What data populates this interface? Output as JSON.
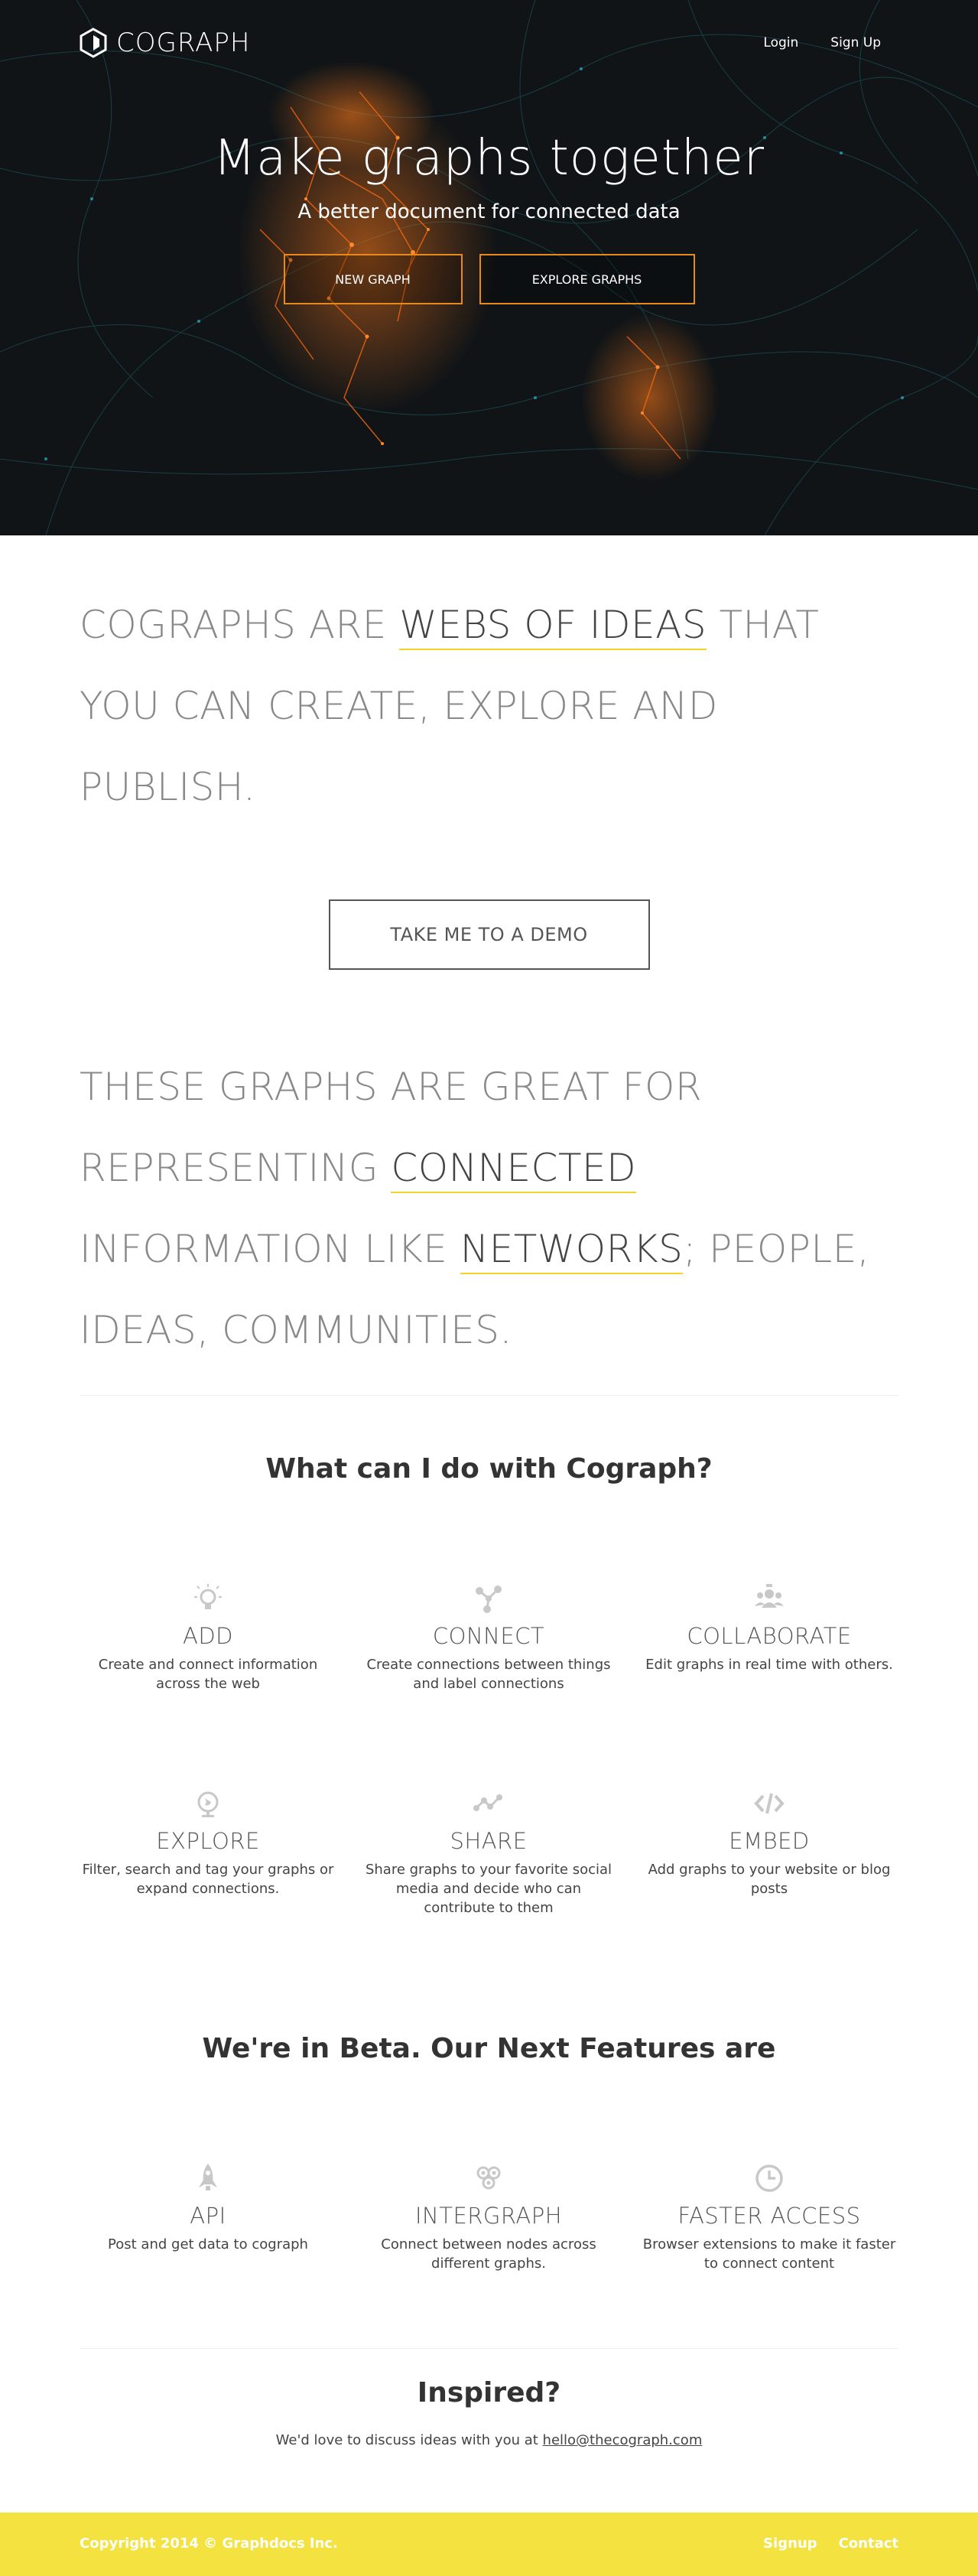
{
  "header": {
    "logo_text": "COGRAPH",
    "nav": {
      "login": "Login",
      "signup": "Sign Up"
    }
  },
  "hero": {
    "title": "Make graphs together",
    "subtitle": "A better document for connected data",
    "new_graph": "NEW GRAPH",
    "explore_graphs": "EXPLORE GRAPHS"
  },
  "statement1": {
    "before": "COGRAPHS ARE ",
    "highlight": "WEBS OF IDEAS",
    "after": " THAT YOU CAN CREATE, EXPLORE AND PUBLISH."
  },
  "demo_button": "TAKE ME TO A DEMO",
  "statement2": {
    "part1": "THESE GRAPHS ARE GREAT FOR REPRESENTING ",
    "highlight1": "CONNECTED",
    "part2": " INFORMATION LIKE ",
    "highlight2": "NETWORKS",
    "part3": "; PEOPLE, IDEAS, COMMUNITIES."
  },
  "what_title": "What can I do with Cograph?",
  "features": [
    {
      "icon": "lightbulb-icon",
      "title": "ADD",
      "desc": "Create and connect information across the web"
    },
    {
      "icon": "connect-icon",
      "title": "CONNECT",
      "desc": "Create connections between things and label connections"
    },
    {
      "icon": "people-icon",
      "title": "COLLABORATE",
      "desc": "Edit graphs in real time with others."
    },
    {
      "icon": "globe-icon",
      "title": "EXPLORE",
      "desc": "Filter, search and tag your graphs or expand connections."
    },
    {
      "icon": "share-icon",
      "title": "SHARE",
      "desc": "Share graphs to your favorite social media and decide who can contribute to them"
    },
    {
      "icon": "code-icon",
      "title": "EMBED",
      "desc": "Add graphs to your website or blog posts"
    }
  ],
  "beta_title": "We're in Beta. Our Next Features are",
  "next_features": [
    {
      "icon": "rocket-icon",
      "title": "API",
      "desc": "Post and get data to cograph"
    },
    {
      "icon": "gears-icon",
      "title": "INTERGRAPH",
      "desc": "Connect between nodes across different graphs."
    },
    {
      "icon": "clock-icon",
      "title": "FASTER ACCESS",
      "desc": "Browser extensions to make it faster to connect content"
    }
  ],
  "inspired": {
    "title": "Inspired?",
    "text": "We'd love to discuss ideas with you at ",
    "email": "hello@thecograph.com"
  },
  "footer": {
    "copyright": "Copyright 2014 © Graphdocs Inc.",
    "signup": "Signup",
    "contact": "Contact"
  },
  "colors": {
    "accent_yellow": "#f3e23f",
    "hero_orange": "#e8891c",
    "hero_bg": "#101417"
  }
}
